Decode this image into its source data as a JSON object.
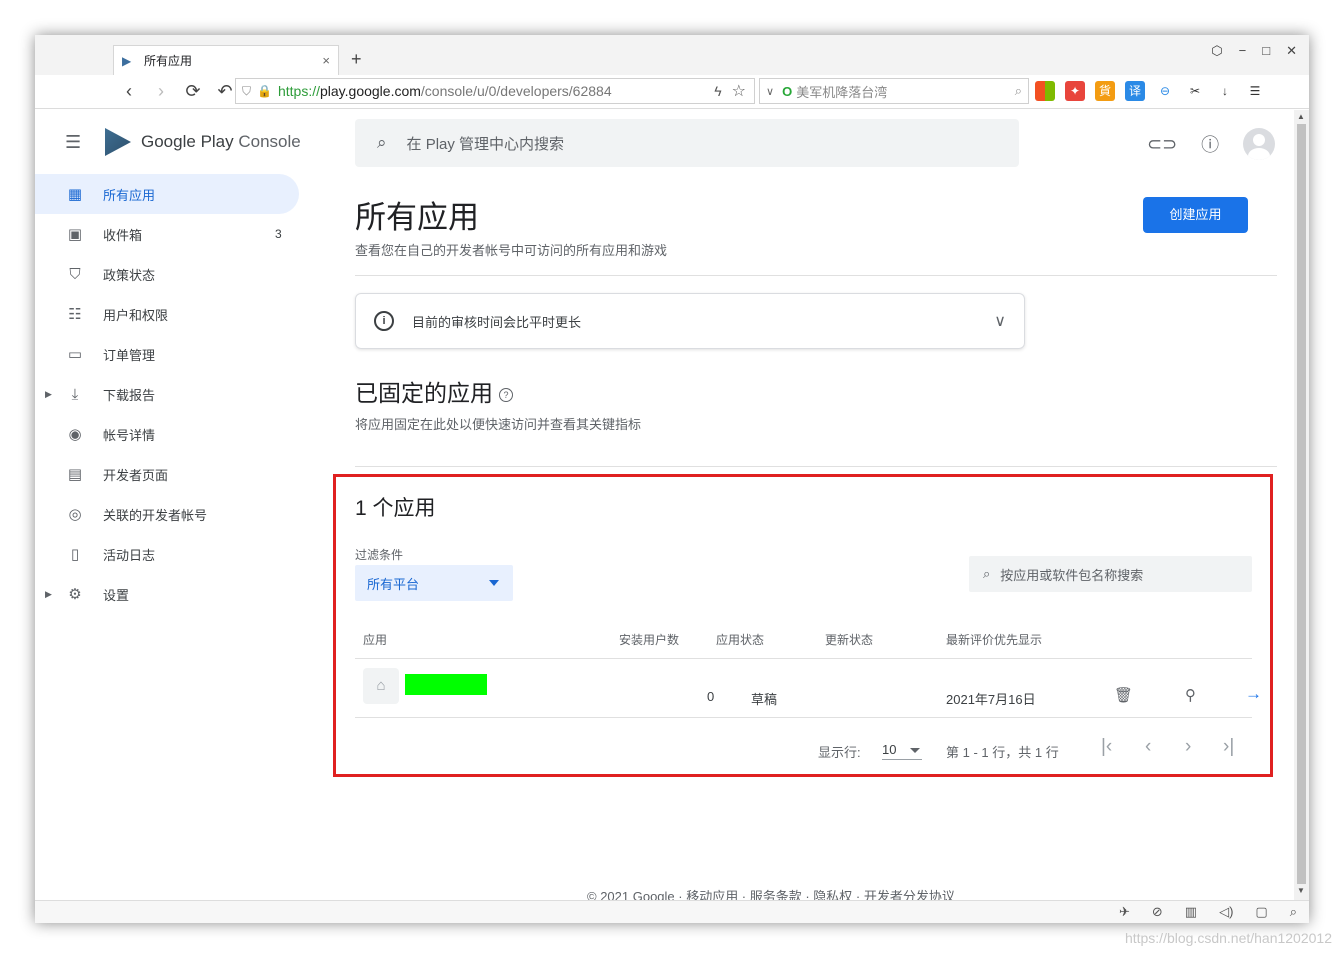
{
  "browser": {
    "tab_title": "所有应用",
    "tab_close": "×",
    "new_tab": "+",
    "window_controls": [
      "⬡",
      "−",
      "□",
      "✕"
    ],
    "nav": {
      "back": "‹",
      "forward": "›",
      "reload": "⟳",
      "undo": "↶"
    },
    "url": {
      "scheme": "https://",
      "host": "play.google.com",
      "path": "/console/u/0/developers/62884"
    },
    "search_engine_text": "美军机降落台湾",
    "extensions": [
      "apps-icon",
      "game-icon",
      "貨",
      "译",
      "⊖",
      "✂",
      "↓",
      "☰"
    ]
  },
  "sidebar": {
    "brand": {
      "google": "Google",
      "play": "Play",
      "console": "Console"
    },
    "items": [
      {
        "label": "所有应用",
        "icon": "grid-icon",
        "glyph": "▦",
        "active": true
      },
      {
        "label": "收件箱",
        "icon": "inbox-icon",
        "glyph": "▣",
        "count": "3"
      },
      {
        "label": "政策状态",
        "icon": "shield-icon",
        "glyph": "⛉"
      },
      {
        "label": "用户和权限",
        "icon": "users-icon",
        "glyph": "☷"
      },
      {
        "label": "订单管理",
        "icon": "credit-card-icon",
        "glyph": "▭"
      },
      {
        "label": "下载报告",
        "icon": "download-icon",
        "glyph": "⤓",
        "expandable": true
      },
      {
        "label": "帐号详情",
        "icon": "account-icon",
        "glyph": "◉"
      },
      {
        "label": "开发者页面",
        "icon": "web-icon",
        "glyph": "▤"
      },
      {
        "label": "关联的开发者帐号",
        "icon": "linked-icon",
        "glyph": "◎"
      },
      {
        "label": "活动日志",
        "icon": "log-icon",
        "glyph": "▯"
      },
      {
        "label": "设置",
        "icon": "gear-icon",
        "glyph": "⚙",
        "expandable": true
      }
    ]
  },
  "header": {
    "search_placeholder": "在 Play 管理中心内搜索"
  },
  "main": {
    "title": "所有应用",
    "subtitle": "查看您在自己的开发者帐号中可访问的所有应用和游戏",
    "create_button": "创建应用",
    "notice": "目前的审核时间会比平时更长",
    "pinned_title": "已固定的应用",
    "pinned_subtitle": "将应用固定在此处以便快速访问并查看其关键指标",
    "apps_count": "1 个应用",
    "filter_label": "过滤条件",
    "filter_value": "所有平台",
    "app_search_placeholder": "按应用或软件包名称搜索",
    "table": {
      "headers": [
        "应用",
        "安装用户数",
        "应用状态",
        "更新状态",
        "最新评价优先显示"
      ],
      "rows": [
        {
          "installs": "0",
          "app_status": "草稿",
          "update_status": "",
          "date": "2021年7月16日"
        }
      ]
    },
    "pagination": {
      "rows_label": "显示行:",
      "rows_value": "10",
      "range": "第 1 - 1 行，共 1 行"
    },
    "footer": "© 2021 Google  · 移动应用  · 服务条款  · 隐私权  · 开发者分发协议"
  },
  "watermark": "https://blog.csdn.net/han1202012",
  "colors": {
    "accent": "#1a73e8",
    "highlight_box": "#e02020",
    "redacted_name": "#00ff00",
    "active_nav_bg": "#e8f0fe"
  }
}
